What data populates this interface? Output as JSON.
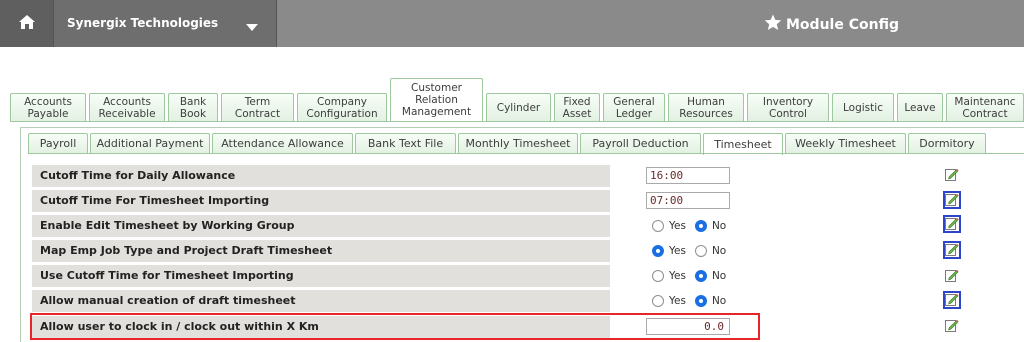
{
  "header": {
    "company_name": "Synergix Technologies",
    "module_title": "Module Config"
  },
  "module_tabs": [
    {
      "lines": [
        "Accounts",
        "Payable"
      ],
      "active": false
    },
    {
      "lines": [
        "Accounts",
        "Receivable"
      ],
      "active": false
    },
    {
      "lines": [
        "Bank",
        "Book"
      ],
      "active": false
    },
    {
      "lines": [
        "Term",
        "Contract"
      ],
      "active": false
    },
    {
      "lines": [
        "Company",
        "Configuration"
      ],
      "active": false
    },
    {
      "lines": [
        "Customer",
        "Relation",
        "Management"
      ],
      "active": true
    },
    {
      "lines": [
        "Cylinder"
      ],
      "active": false
    },
    {
      "lines": [
        "Fixed",
        "Asset"
      ],
      "active": false
    },
    {
      "lines": [
        "General",
        "Ledger"
      ],
      "active": false
    },
    {
      "lines": [
        "Human",
        "Resources"
      ],
      "active": false
    },
    {
      "lines": [
        "Inventory",
        "Control"
      ],
      "active": false
    },
    {
      "lines": [
        "Logistic"
      ],
      "active": false
    },
    {
      "lines": [
        "Leave"
      ],
      "active": false
    },
    {
      "lines": [
        "Maintenanc",
        "Contract"
      ],
      "active": false
    }
  ],
  "sub_tabs": [
    {
      "label": "Payroll",
      "active": false
    },
    {
      "label": "Additional Payment",
      "active": false
    },
    {
      "label": "Attendance Allowance",
      "active": false
    },
    {
      "label": "Bank Text File",
      "active": false
    },
    {
      "label": "Monthly Timesheet",
      "active": false
    },
    {
      "label": "Payroll Deduction",
      "active": false
    },
    {
      "label": "Timesheet",
      "active": true
    },
    {
      "label": "Weekly Timesheet",
      "active": false
    },
    {
      "label": "Dormitory",
      "active": false
    }
  ],
  "settings": [
    {
      "label": "Cutoff Time for Daily Allowance",
      "type": "text",
      "value": "16:00",
      "edit_boxed": false
    },
    {
      "label": "Cutoff Time For Timesheet Importing",
      "type": "text",
      "value": "07:00",
      "edit_boxed": true
    },
    {
      "label": "Enable Edit Timesheet by Working Group",
      "type": "radio",
      "selected": "No",
      "edit_boxed": true
    },
    {
      "label": "Map Emp Job Type and Project Draft Timesheet",
      "type": "radio",
      "selected": "Yes",
      "edit_boxed": true
    },
    {
      "label": "Use Cutoff Time for Timesheet Importing",
      "type": "radio",
      "selected": "No",
      "edit_boxed": false
    },
    {
      "label": "Allow manual creation of draft timesheet",
      "type": "radio",
      "selected": "No",
      "edit_boxed": true
    },
    {
      "label": "Allow user to clock in / clock out within X Km",
      "type": "number",
      "value": "0.0",
      "edit_boxed": false
    }
  ],
  "radio_options": {
    "yes": "Yes",
    "no": "No"
  },
  "icons": {
    "home": "home-icon",
    "dropdown": "caret-down-icon",
    "module": "star-icon",
    "edit": "edit-pencil-icon"
  },
  "colors": {
    "tab_border": "#9ec89e",
    "label_bg": "#e2e0dd",
    "radio_selected": "#1a6fe3",
    "highlight": "#e8262a",
    "edit_border": "#2d46c8"
  }
}
